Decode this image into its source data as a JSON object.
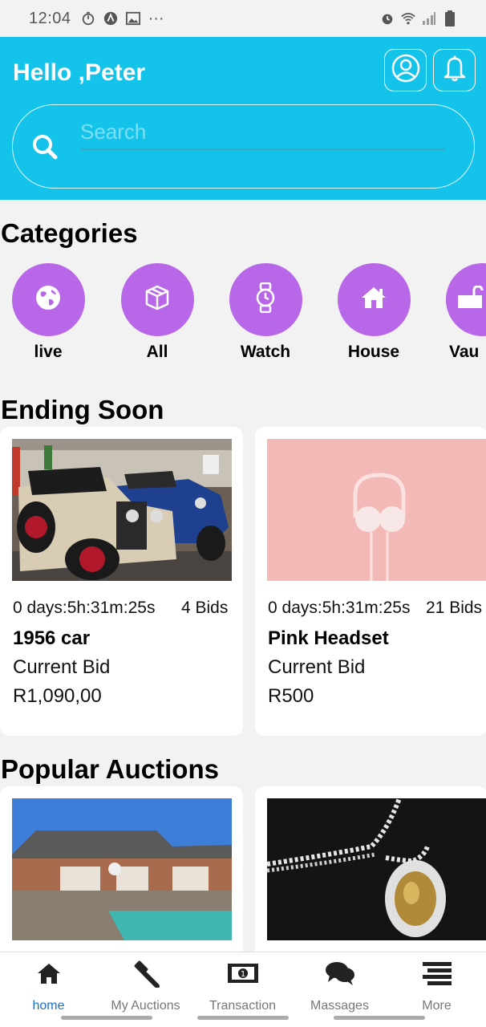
{
  "status_bar": {
    "time": "12:04",
    "more": "···"
  },
  "header": {
    "greeting": "Hello ,Peter"
  },
  "search": {
    "placeholder": "Search"
  },
  "categories": {
    "title": "Categories",
    "items": [
      {
        "label": "live",
        "icon": "globe-icon"
      },
      {
        "label": "All",
        "icon": "box-icon"
      },
      {
        "label": "Watch",
        "icon": "watch-icon"
      },
      {
        "label": "House",
        "icon": "house-icon"
      },
      {
        "label": "Vau",
        "icon": "vault-icon"
      }
    ]
  },
  "ending_soon": {
    "title": "Ending Soon",
    "items": [
      {
        "time_left": "0 days:5h:31m:25s",
        "bids": "4 Bids",
        "name": "1956 car",
        "current_bid_label": "Current Bid",
        "price": "R1,090,00"
      },
      {
        "time_left": "0 days:5h:31m:25s",
        "bids": "21 Bids",
        "name": "Pink Headset",
        "current_bid_label": "Current Bid",
        "price": "R500"
      }
    ]
  },
  "popular_auctions": {
    "title": "Popular Auctions"
  },
  "bottom_nav": {
    "items": [
      {
        "label": "home",
        "icon": "home-icon",
        "active": true
      },
      {
        "label": "My Auctions",
        "icon": "gavel-icon"
      },
      {
        "label": "Transaction",
        "icon": "money-icon"
      },
      {
        "label": "Massages",
        "icon": "chat-icon"
      },
      {
        "label": "More",
        "icon": "menu-icon"
      }
    ]
  },
  "colors": {
    "header": "#14c3ea",
    "category": "#b867e8",
    "active_nav": "#1a6fc9"
  }
}
